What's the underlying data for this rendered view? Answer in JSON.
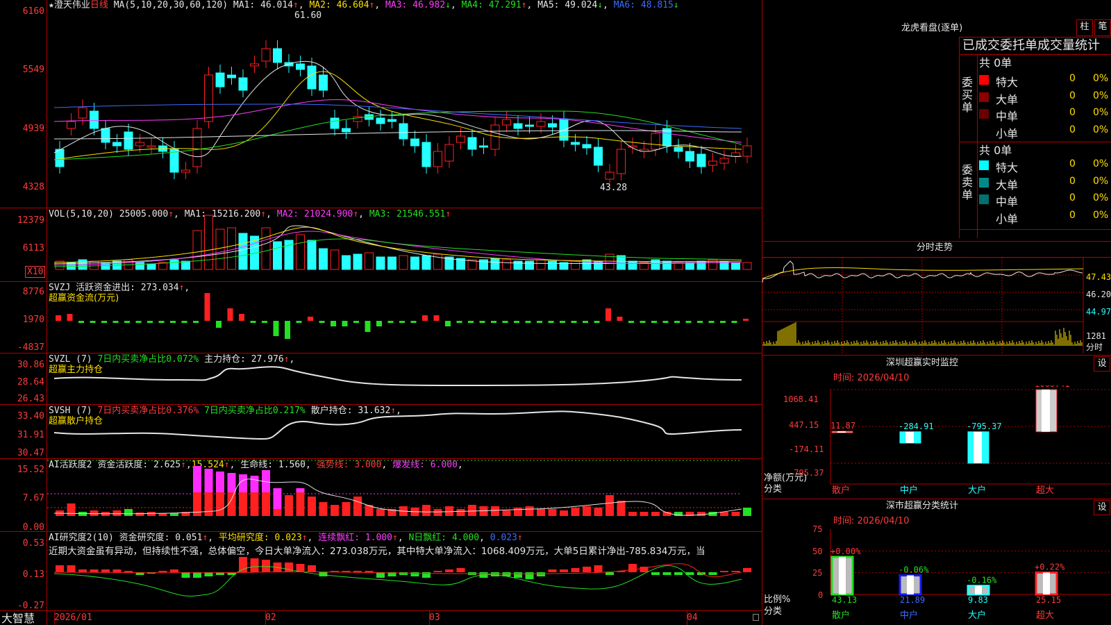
{
  "stock": {
    "name": "澄天伟业",
    "period": "日线",
    "ma_label": "MA(5,10,20,30,60,120)",
    "ma1": "MA1: 46.014",
    "ma2": "MA2: 46.604",
    "ma3": "MA3: 46.982",
    "ma4": "MA4: 47.291",
    "ma5": "MA5: 49.024",
    "ma6": "MA6: 48.815",
    "high_mark": "61.60",
    "low_mark": "43.28",
    "y_labels": [
      "6160",
      "5549",
      "4939",
      "4328"
    ]
  },
  "vol_panel": {
    "title": "VOL(5,10,20)",
    "value": "25005.000",
    "ma1": "MA1: 15216.200",
    "ma2": "MA2: 21024.900",
    "ma3": "MA3: 21546.551",
    "y_labels": [
      "12379",
      "6113"
    ],
    "unit": "X10"
  },
  "svzj_panel": {
    "title": "SVZJ",
    "label": "活跃资金进出: 273.034",
    "name": "超赢资金流(万元)",
    "y_labels": [
      "8776",
      "1970",
      "-4837"
    ]
  },
  "svzl_panel": {
    "title": "SVZL (7)",
    "label1": "7日内买卖净占比0.072%",
    "label2": "主力持仓: 27.976",
    "name": "超赢主力持仓",
    "y_labels": [
      "30.86",
      "28.64",
      "26.43"
    ]
  },
  "svsh_panel": {
    "title": "SVSH (7)",
    "label1": "7日内买卖净占比0.376%",
    "label2": "7日内买卖净占比0.217%",
    "label3": "散户持仓: 31.632",
    "name": "超赢散户持仓",
    "y_labels": [
      "33.40",
      "31.91",
      "30.47"
    ]
  },
  "ai_active_panel": {
    "title": "AI活跃度2",
    "label1": "资金活跃度: 2.625",
    "label2": "15.524",
    "label3": "生命线: 1.560",
    "label4": "强势线: 3.000",
    "label5": "爆发线: 6.000",
    "y_labels": [
      "15.52",
      "7.67",
      "0.00"
    ]
  },
  "ai_research_panel": {
    "title": "AI研究度2(10)",
    "label1": "资金研究度: 0.051",
    "label2": "平均研究度: 0.023",
    "label3": "连续飘红: 1.000",
    "label4": "N日飘红: 4.000",
    "label5": "0.023",
    "commentary": "近期大资金虽有异动，但持续性不强，总体偏空，今日大单净流入：273.038万元，其中特大单净流入：1068.409万元，大单5日累计净出-785.834万元，当",
    "y_labels": [
      "0.53",
      "0.13",
      "-0.27"
    ]
  },
  "x_axis": [
    "2026/01",
    "02",
    "03",
    "04"
  ],
  "logo": "大智慧",
  "dragon": {
    "title": "龙虎看盘(逐单)",
    "btn_bar": "柱",
    "btn_pen": "笔",
    "subtitle": "已成交委托单成交量统计",
    "buy_side": "委买单",
    "sell_side": "委卖单",
    "buy_total": "共 0单",
    "sell_total": "共 0单",
    "rows_buy": [
      {
        "label": "特大",
        "count": "0",
        "pct": "0%",
        "color": "#ff0000"
      },
      {
        "label": "大单",
        "count": "0",
        "pct": "0%",
        "color": "#8b0000"
      },
      {
        "label": "中单",
        "count": "0",
        "pct": "0%",
        "color": "#6a0000"
      },
      {
        "label": "小单",
        "count": "0",
        "pct": "0%",
        "color": ""
      }
    ],
    "rows_sell": [
      {
        "label": "特大",
        "count": "0",
        "pct": "0%",
        "color": "#00ffff"
      },
      {
        "label": "大单",
        "count": "0",
        "pct": "0%",
        "color": "#008b8b"
      },
      {
        "label": "中单",
        "count": "0",
        "pct": "0%",
        "color": "#007070"
      },
      {
        "label": "小单",
        "count": "0",
        "pct": "0%",
        "color": ""
      }
    ]
  },
  "intraday": {
    "title": "分时走势",
    "y_labels": [
      "47.43",
      "46.20",
      "44.97"
    ],
    "vol_label": "1281",
    "vol_unit": "分时"
  },
  "monitor": {
    "title": "深圳超赢实时监控",
    "settings": "设",
    "time": "时间: 2026/04/10",
    "y_labels": [
      "1068.41",
      "447.15",
      "-174.11",
      "-795.37"
    ],
    "unit_label": "净额(万元)",
    "cat_label": "分类",
    "chart_data": {
      "type": "bar",
      "categories": [
        "散户",
        "中户",
        "大户",
        "超大"
      ],
      "values": [
        11.87,
        -284.91,
        -795.37,
        1068.41
      ],
      "ylim": [
        -795.37,
        1068.41
      ]
    }
  },
  "classify": {
    "title": "深市超赢分类统计",
    "settings": "设",
    "time": "时间: 2026/04/10",
    "y_labels": [
      "75",
      "50",
      "25",
      "0"
    ],
    "unit_label": "比例%",
    "cat_label": "分类",
    "chart_data": {
      "type": "bar",
      "categories": [
        "散户",
        "中户",
        "大户",
        "超大"
      ],
      "values": [
        43.13,
        21.89,
        9.83,
        25.15
      ],
      "changes": [
        "+0.00%",
        "-0.06%",
        "-0.16%",
        "+0.22%"
      ],
      "ylim": [
        0,
        75
      ]
    }
  },
  "colors": {
    "up": "#ff2020",
    "down": "#25ffff",
    "grid": "#b00000",
    "accent": "#ffe000"
  }
}
